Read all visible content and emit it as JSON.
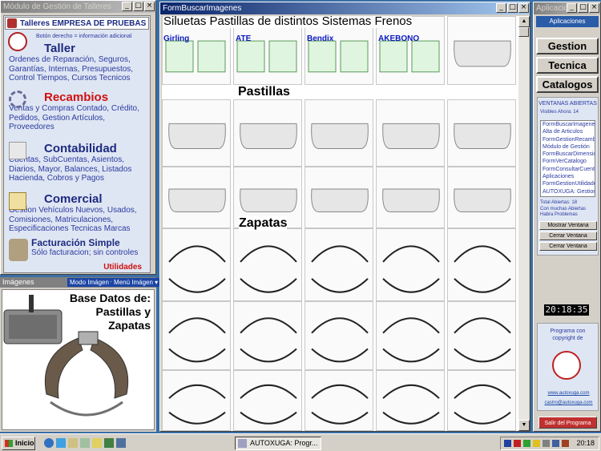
{
  "left_window": {
    "title": "Módulo de Gestión de Talleres",
    "header": "Talleres EMPRESA DE PRUEBAS",
    "hint": "Botón derecho = información adicional",
    "sections": [
      {
        "title": "Taller",
        "text": "Ordenes de Reparación, Seguros, Garantías, Internas, Presupuestos, Control Tiempos, Cursos Tecnicos"
      },
      {
        "title": "Recambios",
        "text": "Ventas y Compras Contado, Crédito, Pedidos, Gestion Artículos, Proveedores"
      },
      {
        "title": "Contabilidad",
        "text": "Cuentas, SubCuentas, Asientos, Diarios, Mayor, Balances, Listados Hacienda, Cobros y Pagos"
      },
      {
        "title": "Comercial",
        "text": "Gestion Vehículos Nuevos, Usados, Comisiones, Matriculaciones, Especificaciones Tecnicas Marcas"
      },
      {
        "title": "Facturación Simple",
        "text": "Sólo facturacion; sin controles"
      }
    ],
    "utilidades": "Utilidades"
  },
  "images_panel": {
    "label": "Imágenes",
    "mode_menu": "Modo Imágen",
    "image_menu": "Menú Imágen",
    "caption_line1": "Base Datos de:",
    "caption_line2": "Pastillas y",
    "caption_line3": "Zapatas"
  },
  "main_window": {
    "title": "FormBuscarImagenes",
    "header_title": "Siluetas Pastillas de distintos Sistemas Frenos",
    "brands": [
      "Girling",
      "ATE",
      "Bendix",
      "AKEBONO"
    ],
    "section_pastillas": "Pastillas",
    "section_zapatas": "Zapatas"
  },
  "right_window": {
    "title": "Aplicaciones",
    "tab": "Aplicaciones",
    "buttons": [
      "Gestion",
      "Tecnica",
      "Catalogos"
    ],
    "open_windows_label": "VENTANAS ABIERTAS",
    "visible_label": "Visibles Ahora: 14",
    "window_list": [
      "FormBuscarImagenes",
      "Alta de Articulos",
      "FormGestionRecambios",
      "Módulo de Gestión",
      "FormBuscarDimensiones",
      "FormVerCatalogo",
      "FormConsultarCuentas",
      "Aplicaciones",
      "FormGestionUtilidades",
      "AUTOXUGA: Gestion"
    ],
    "total_open": "Total Abiertas: 18",
    "problems": "Con muchas Abiertas Habra Problemas",
    "btn_show": "Mostrar Ventana",
    "btn_close": "Cerrar Ventana",
    "btn_hide": "Cerrar Ventana",
    "clock": "20:18:35",
    "program_by": "Programa con copyright de",
    "website": "www.autoxuga.com",
    "email": "castro@autoxuga.com",
    "exit": "Salir del Programa"
  },
  "taskbar": {
    "start": "Inicio",
    "task": "AUTOXUGA: Progr...",
    "time": "20:18"
  }
}
